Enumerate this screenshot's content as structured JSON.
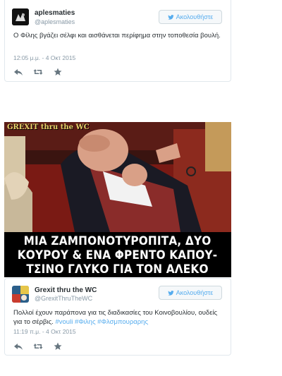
{
  "tweet1": {
    "name": "aplesmaties",
    "handle": "@aplesmaties",
    "follow_label": "Ακολουθήστε",
    "text": "Ο Φίλης βγάζει σέλφι και αισθάνεται περίφημα στην τοποθεσία βουλή.",
    "timestamp": "12:05 μ.μ. - 4 Οκτ 2015"
  },
  "meme": {
    "logo": "GREXIT thru the WC",
    "caption": "ΜΙΑ ΖΑΜΠΟΝΟΤΥΡΟΠΙΤΑ, ΔΥΟ\nΚΟΥΡΟΥ & ΕΝΑ ΦΡΕΝΤΟ ΚΑΠΟΥ-\nΤΣΙΝΟ ΓΛΥΚΟ ΓΙΑ ΤΟΝ ΑΛΕΚΟ"
  },
  "tweet2": {
    "name": "Grexit thru the WC",
    "handle": "@GrexitThruTheWC",
    "follow_label": "Ακολουθήστε",
    "text": "Πολλοί έχουν παράπονα για τις διαδικασίες του Κοινοβουλίου, ουδείς για το σέρβις.",
    "hashtags": "#vouli #Φιλης #Φλσμπουραρης",
    "timestamp": "11:19 π.μ. - 4 Οκτ 2015"
  },
  "colors": {
    "accent": "#55acee",
    "muted": "#8899a6",
    "border": "#e1e8ed"
  }
}
